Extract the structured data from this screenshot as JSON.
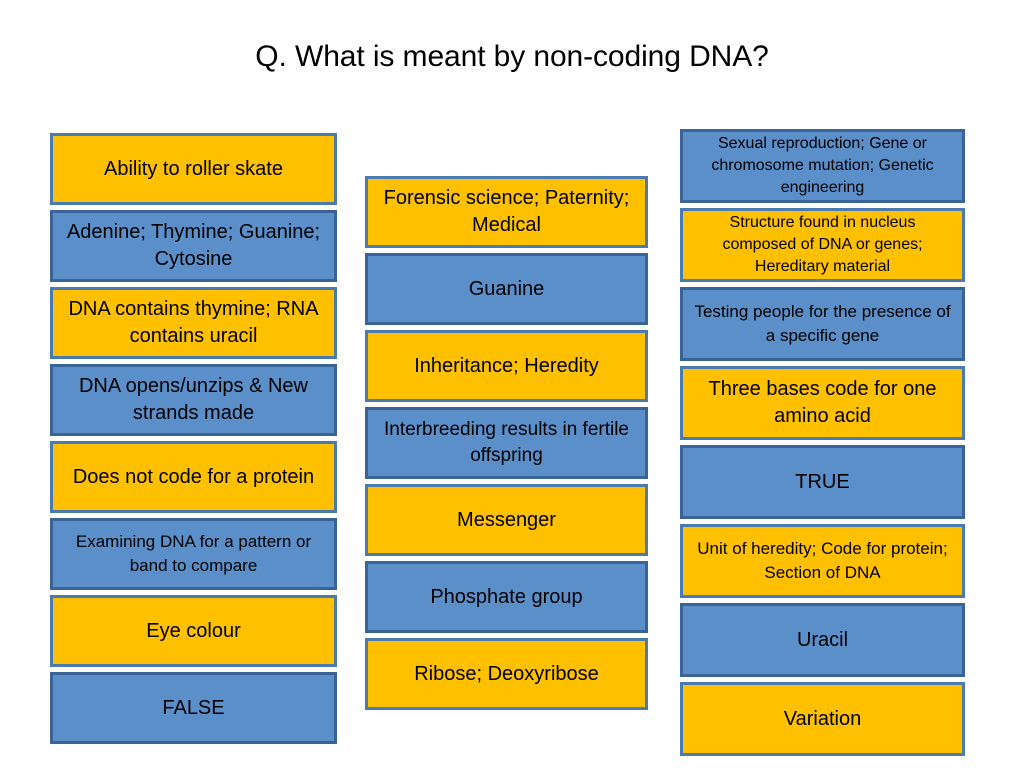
{
  "slide": {
    "title": "Q. What is meant by non-coding DNA?",
    "background_color": "#FFFFFF"
  },
  "theme": {
    "amber_fill": "#FFC000",
    "amber_border": "#4A7BB0",
    "blue_fill": "#5B8FC9",
    "blue_border": "#3A6396",
    "text_color": "#000000"
  },
  "columns": [
    {
      "id": "column-1",
      "boxes": [
        {
          "text": "Ability to roller skate",
          "color": "amber",
          "size": "size-lg",
          "height": "h-1"
        },
        {
          "text": "Adenine; Thymine; Guanine; Cytosine",
          "color": "blue",
          "size": "size-lg",
          "height": "h-1"
        },
        {
          "text": "DNA contains thymine; RNA contains uracil",
          "color": "amber",
          "size": "size-lg",
          "height": "h-1"
        },
        {
          "text": "DNA opens/unzips & New strands made",
          "color": "blue",
          "size": "size-lg",
          "height": "h-1"
        },
        {
          "text": "Does not code for a protein",
          "color": "amber",
          "size": "size-lg",
          "height": "h-1"
        },
        {
          "text": "Examining DNA for a pattern or band to compare",
          "color": "blue",
          "size": "size-sm",
          "height": "h-1"
        },
        {
          "text": "Eye colour",
          "color": "amber",
          "size": "size-lg",
          "height": "h-1"
        },
        {
          "text": "FALSE",
          "color": "blue",
          "size": "size-lg",
          "height": "h-1"
        }
      ]
    },
    {
      "id": "column-2",
      "boxes": [
        {
          "text": "Forensic science; Paternity; Medical",
          "color": "amber",
          "size": "size-lg",
          "height": "h-1"
        },
        {
          "text": "Guanine",
          "color": "blue",
          "size": "size-lg",
          "height": "h-1"
        },
        {
          "text": "Inheritance; Heredity",
          "color": "amber",
          "size": "size-lg",
          "height": "h-1"
        },
        {
          "text": "Interbreeding results in fertile offspring",
          "color": "blue",
          "size": "size-md",
          "height": "h-1"
        },
        {
          "text": "Messenger",
          "color": "amber",
          "size": "size-lg",
          "height": "h-1"
        },
        {
          "text": "Phosphate group",
          "color": "blue",
          "size": "size-lg",
          "height": "h-1"
        },
        {
          "text": "Ribose; Deoxyribose",
          "color": "amber",
          "size": "size-lg",
          "height": "h-1"
        }
      ]
    },
    {
      "id": "column-3",
      "boxes": [
        {
          "text": "Sexual reproduction; Gene or chromosome mutation; Genetic engineering",
          "color": "blue",
          "size": "size-xs",
          "height": "h-2"
        },
        {
          "text": "Structure found in nucleus composed of DNA or genes; Hereditary material",
          "color": "amber",
          "size": "size-xs",
          "height": "h-2"
        },
        {
          "text": "Testing people for the presence of a specific gene",
          "color": "blue",
          "size": "size-sm",
          "height": "h-2"
        },
        {
          "text": "Three bases code for one amino acid",
          "color": "amber",
          "size": "size-lg",
          "height": "h-2"
        },
        {
          "text": "TRUE",
          "color": "blue",
          "size": "size-lg",
          "height": "h-2"
        },
        {
          "text": "Unit of heredity; Code for protein; Section of DNA",
          "color": "amber",
          "size": "size-sm",
          "height": "h-2"
        },
        {
          "text": "Uracil",
          "color": "blue",
          "size": "size-lg",
          "height": "h-2"
        },
        {
          "text": "Variation",
          "color": "amber",
          "size": "size-lg",
          "height": "h-2"
        }
      ]
    }
  ]
}
